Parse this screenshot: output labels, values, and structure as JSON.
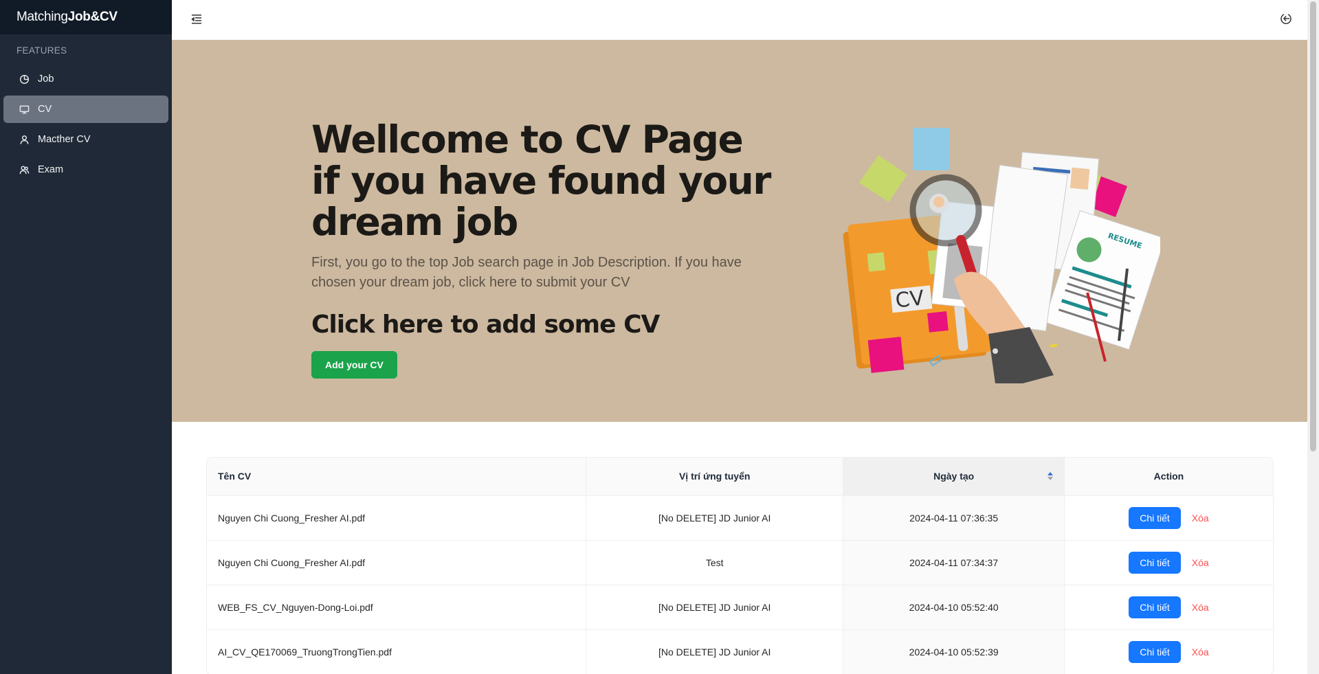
{
  "brand": {
    "prefix": "Matching",
    "bold": "Job&CV"
  },
  "sidebar": {
    "section_label": "FEATURES",
    "items": [
      {
        "label": "Job",
        "icon": "pie-chart-icon",
        "active": false
      },
      {
        "label": "CV",
        "icon": "desktop-icon",
        "active": true
      },
      {
        "label": "Macther CV",
        "icon": "user-icon",
        "active": false
      },
      {
        "label": "Exam",
        "icon": "team-icon",
        "active": false
      }
    ]
  },
  "topbar": {
    "menu_icon": "menu-fold-icon",
    "logout_icon": "logout-icon"
  },
  "hero": {
    "title_line1": "Wellcome to CV Page",
    "title_line2": "if you have found your",
    "title_line3": "dream job",
    "description": "First, you go to the top Job search page in Job Description. If you have chosen your dream job, click here to submit your CV",
    "cta": "Click here to add some CV",
    "add_button": "Add your CV",
    "illustration_folder_label": "CV",
    "illustration_doc_label": "RESUME"
  },
  "table": {
    "headers": {
      "name": "Tên CV",
      "position": "Vị trí ứng tuyển",
      "date": "Ngày tạo",
      "action": "Action"
    },
    "rows": [
      {
        "name": "Nguyen Chi Cuong_Fresher AI.pdf",
        "position": "[No DELETE] JD Junior AI",
        "date": "2024-04-11 07:36:35",
        "detail": "Chi tiết",
        "delete": "Xóa"
      },
      {
        "name": "Nguyen Chi Cuong_Fresher AI.pdf",
        "position": "Test",
        "date": "2024-04-11 07:34:37",
        "detail": "Chi tiết",
        "delete": "Xóa"
      },
      {
        "name": "WEB_FS_CV_Nguyen-Dong-Loi.pdf",
        "position": "[No DELETE] JD Junior AI",
        "date": "2024-04-10 05:52:40",
        "detail": "Chi tiết",
        "delete": "Xóa"
      },
      {
        "name": "AI_CV_QE170069_TruongTrongTien.pdf",
        "position": "[No DELETE] JD Junior AI",
        "date": "2024-04-10 05:52:39",
        "detail": "Chi tiết",
        "delete": "Xóa"
      }
    ]
  },
  "colors": {
    "sidebar_bg": "#1f2937",
    "hero_bg": "#cdb9a0",
    "add_button": "#1aa34a",
    "detail_button": "#1677ff",
    "delete_link": "#ff4d4f"
  }
}
